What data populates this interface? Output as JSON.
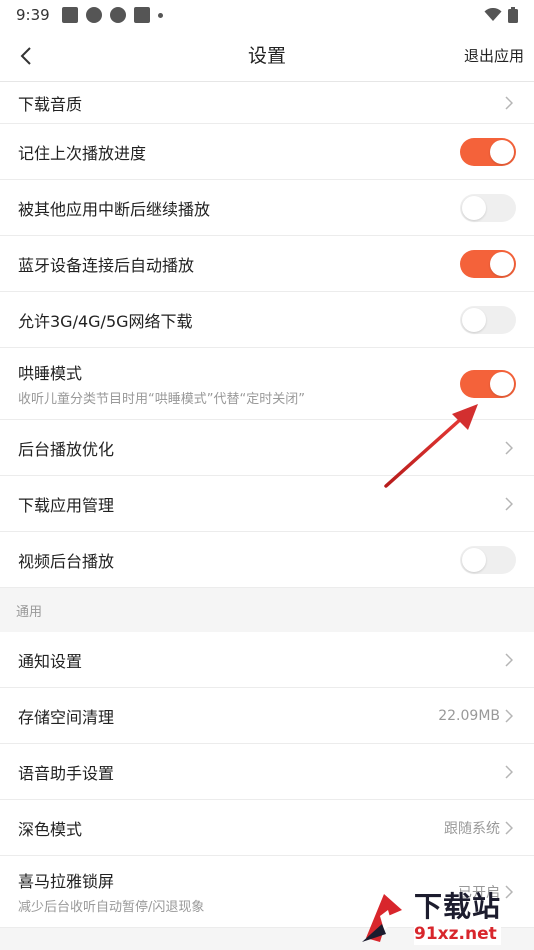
{
  "status_bar": {
    "time": "9:39",
    "icons": [
      "notification-square-icon",
      "app-circle-icon",
      "app-circle-icon",
      "notification-square-icon",
      "dot-icon"
    ],
    "right_icons": [
      "wifi-icon",
      "battery-icon"
    ]
  },
  "header": {
    "back_icon": "chevron-left-icon",
    "title": "设置",
    "exit_label": "退出应用"
  },
  "rows": [
    {
      "label": "下载音质",
      "type": "nav"
    },
    {
      "label": "记住上次播放进度",
      "type": "toggle",
      "on": true
    },
    {
      "label": "被其他应用中断后继续播放",
      "type": "toggle",
      "on": false
    },
    {
      "label": "蓝牙设备连接后自动播放",
      "type": "toggle",
      "on": true
    },
    {
      "label": "允许3G/4G/5G网络下载",
      "type": "toggle",
      "on": false
    },
    {
      "label": "哄睡模式",
      "sub": "收听儿童分类节目时用“哄睡模式”代替“定时关闭”",
      "type": "toggle",
      "on": true
    },
    {
      "label": "后台播放优化",
      "type": "nav"
    },
    {
      "label": "下载应用管理",
      "type": "nav"
    },
    {
      "label": "视频后台播放",
      "type": "toggle",
      "on": false
    }
  ],
  "section_general": {
    "title": "通用",
    "rows": [
      {
        "label": "通知设置",
        "type": "nav"
      },
      {
        "label": "存储空间清理",
        "type": "nav",
        "value": "22.09MB"
      },
      {
        "label": "语音助手设置",
        "type": "nav"
      },
      {
        "label": "深色模式",
        "type": "nav",
        "value": "跟随系统"
      },
      {
        "label": "喜马拉雅锁屏",
        "sub": "减少后台收听自动暂停/闪退现象",
        "type": "nav",
        "value": "已开启"
      }
    ]
  },
  "colors": {
    "accent": "#f4623a",
    "toggle_off": "#efefef",
    "arrow": "#d8262c"
  },
  "watermark": {
    "title": "下载站",
    "url": "91xz.net"
  }
}
